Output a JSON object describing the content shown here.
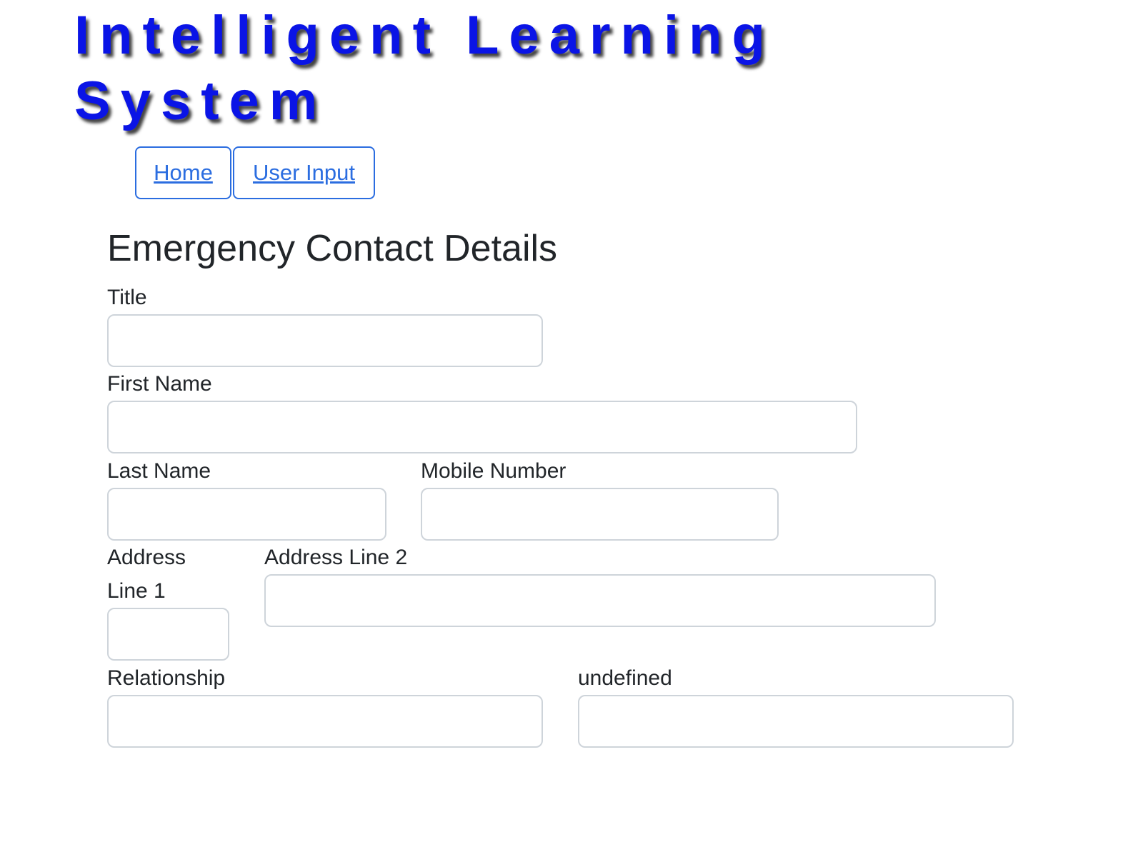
{
  "app_title": "Intelligent Learning System",
  "nav": {
    "home_label": "Home",
    "user_input_label": "User Input"
  },
  "form": {
    "heading": "Emergency Contact Details",
    "title_label": "Title",
    "title_value": "",
    "first_name_label": "First Name",
    "first_name_value": "",
    "last_name_label": "Last Name",
    "last_name_value": "",
    "mobile_number_label": "Mobile Number",
    "mobile_number_value": "",
    "address_line1_label_part1": "Address",
    "address_line1_label_part2": "Line 1",
    "address_line1_value": "",
    "address_line2_label": "Address Line 2",
    "address_line2_value": "",
    "relationship_label": "Relationship",
    "relationship_value": "",
    "undefined_label": "undefined",
    "undefined_value": ""
  },
  "colors": {
    "title_blue": "#0a14e6",
    "link_blue": "#2b6de0",
    "input_border": "#ced4da",
    "text": "#212529"
  }
}
